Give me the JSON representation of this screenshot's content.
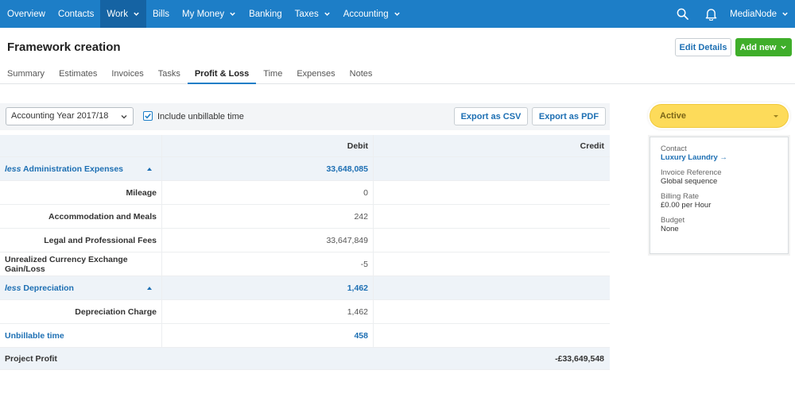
{
  "nav": {
    "items": [
      {
        "label": "Overview",
        "dropdown": false
      },
      {
        "label": "Contacts",
        "dropdown": false
      },
      {
        "label": "Work",
        "dropdown": true
      },
      {
        "label": "Bills",
        "dropdown": false
      },
      {
        "label": "My Money",
        "dropdown": true
      },
      {
        "label": "Banking",
        "dropdown": false
      },
      {
        "label": "Taxes",
        "dropdown": true
      },
      {
        "label": "Accounting",
        "dropdown": true
      }
    ],
    "active_index": 2,
    "org_name": "MediaNode",
    "search_icon": "search-icon",
    "bell_icon": "bell-icon"
  },
  "header": {
    "title": "Framework creation",
    "edit_label": "Edit Details",
    "add_label": "Add new"
  },
  "tabs": [
    {
      "label": "Summary"
    },
    {
      "label": "Estimates"
    },
    {
      "label": "Invoices"
    },
    {
      "label": "Tasks"
    },
    {
      "label": "Profit & Loss"
    },
    {
      "label": "Time"
    },
    {
      "label": "Expenses"
    },
    {
      "label": "Notes"
    }
  ],
  "active_tab_index": 4,
  "filters": {
    "year": "Accounting Year 2017/18",
    "include_unbillable_label": "Include unbillable time",
    "include_unbillable_checked": true,
    "export_csv": "Export as CSV",
    "export_pdf": "Export as PDF"
  },
  "table": {
    "headers": [
      "",
      "Debit",
      "Credit"
    ],
    "groups": [
      {
        "prefix": "less",
        "label": "Administration Expenses",
        "debit": "33,648,085",
        "rows": [
          {
            "label": "Mileage",
            "debit": "0"
          },
          {
            "label": "Accommodation and Meals",
            "debit": "242"
          },
          {
            "label": "Legal and Professional Fees",
            "debit": "33,647,849"
          },
          {
            "label": "Unrealized Currency Exchange Gain/Loss",
            "debit": "-5"
          }
        ]
      },
      {
        "prefix": "less",
        "label": "Depreciation",
        "debit": "1,462",
        "rows": [
          {
            "label": "Depreciation Charge",
            "debit": "1,462"
          }
        ]
      }
    ],
    "unbillable": {
      "label": "Unbillable time",
      "debit": "458"
    },
    "total": {
      "label": "Project Profit",
      "credit": "-£33,649,548"
    }
  },
  "sidebar": {
    "status": "Active",
    "contact_label": "Contact",
    "contact_value": "Luxury Laundry →",
    "invoice_ref_label": "Invoice Reference",
    "invoice_ref_value": "Global sequence",
    "billing_rate_label": "Billing Rate",
    "billing_rate_value": "£0.00 per Hour",
    "budget_label": "Budget",
    "budget_value": "None"
  },
  "colors": {
    "nav_bg": "#1d7ec7",
    "nav_active": "#1563a3",
    "accent_blue": "#1d6fb3",
    "add_green": "#3fae2a",
    "status_yellow": "#fddb5a"
  }
}
